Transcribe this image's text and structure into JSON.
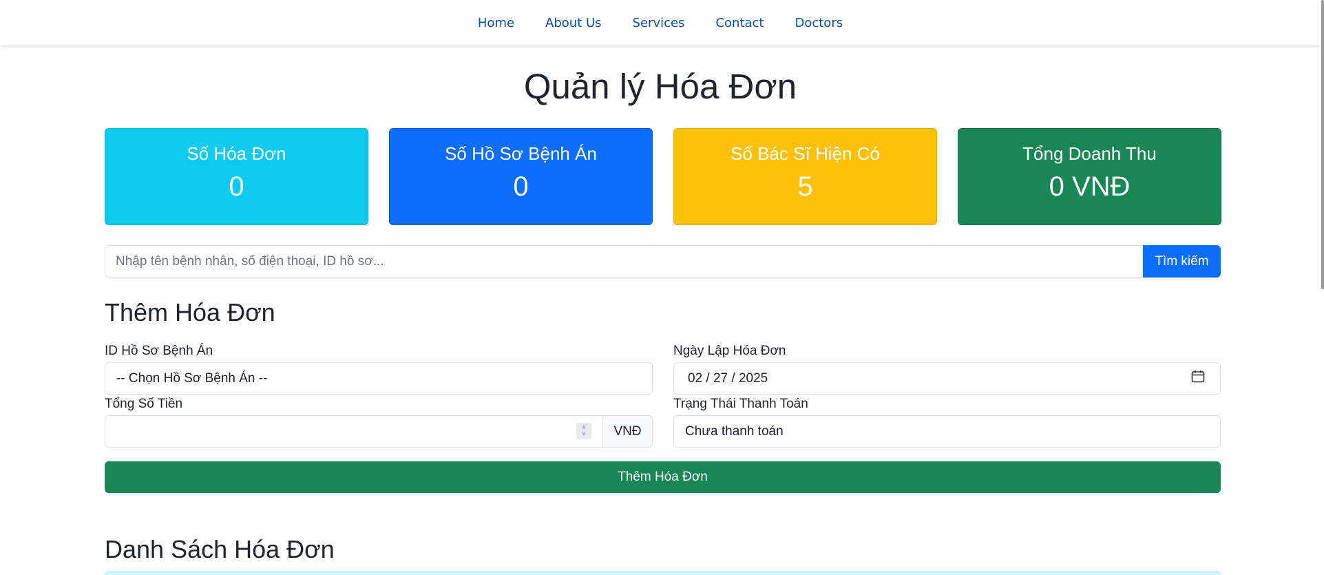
{
  "nav": {
    "items": [
      "Home",
      "About Us",
      "Services",
      "Contact",
      "Doctors"
    ]
  },
  "page": {
    "title": "Quản lý Hóa Đơn"
  },
  "stats": [
    {
      "label": "Số Hóa Đơn",
      "value": "0",
      "color": "#0dcaf0"
    },
    {
      "label": "Số Hồ Sơ Bệnh Án",
      "value": "0",
      "color": "#0d6efd"
    },
    {
      "label": "Số Bác Sĩ Hiện Có",
      "value": "5",
      "color": "#ffc107"
    },
    {
      "label": "Tổng Doanh Thu",
      "value": "0 VNĐ",
      "color": "#198754"
    }
  ],
  "search": {
    "placeholder": "Nhập tên bệnh nhân, số điện thoại, ID hồ sơ...",
    "value": "",
    "button_label": "Tìm kiếm"
  },
  "add_form": {
    "title": "Thêm Hóa Đơn",
    "record_id_label": "ID Hồ Sơ Bệnh Án",
    "record_id_value": "-- Chọn Hồ Sơ Bệnh Án --",
    "date_label": "Ngày Lập Hóa Đơn",
    "date_value": "02 / 27 / 2025",
    "amount_label": "Tổng Số Tiền",
    "amount_value": "",
    "currency": "VNĐ",
    "status_label": "Trạng Thái Thanh Toán",
    "status_value": "Chưa thanh toán",
    "submit_label": "Thêm Hóa Đơn"
  },
  "list": {
    "title": "Danh Sách Hóa Đơn"
  },
  "icons": {
    "calendar": "calendar-icon",
    "stepper_up": "chevron-up-icon",
    "stepper_down": "chevron-down-icon"
  }
}
